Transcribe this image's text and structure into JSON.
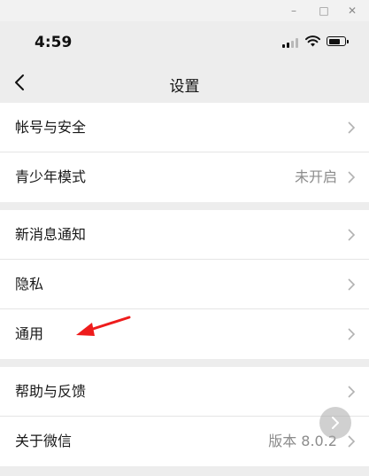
{
  "status_bar": {
    "time": "4:59"
  },
  "nav": {
    "title": "设置"
  },
  "groups": [
    {
      "rows": [
        {
          "label": "帐号与安全",
          "value": ""
        },
        {
          "label": "青少年模式",
          "value": "未开启"
        }
      ]
    },
    {
      "rows": [
        {
          "label": "新消息通知",
          "value": ""
        },
        {
          "label": "隐私",
          "value": ""
        },
        {
          "label": "通用",
          "value": ""
        }
      ]
    },
    {
      "rows": [
        {
          "label": "帮助与反馈",
          "value": ""
        },
        {
          "label": "关于微信",
          "value": "版本 8.0.2"
        }
      ]
    }
  ],
  "colors": {
    "annotation_arrow": "#ee1c1c",
    "background": "#ededed"
  },
  "icons": [
    "minimize-icon",
    "maximize-icon",
    "close-icon",
    "signal-icon",
    "wifi-icon",
    "battery-icon",
    "back-icon",
    "chevron-right-icon",
    "floating-arrow-icon"
  ]
}
